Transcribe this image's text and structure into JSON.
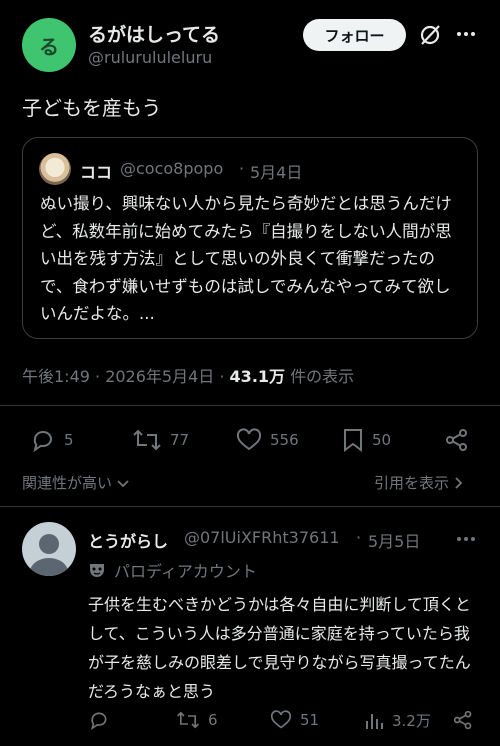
{
  "post": {
    "author_name": "るがはしってる",
    "author_handle": "@rulurululeluru",
    "avatar_glyph": "る",
    "follow_label": "フォロー",
    "text": "子どもを産もう",
    "timestamp": "午後1:49 · 2026年5月4日 ·",
    "views_count": "43.1万",
    "views_label": "件の表示"
  },
  "quote": {
    "name": "ココ",
    "handle": "@coco8popo",
    "dot": "·",
    "date": "5月4日",
    "body": "ぬい撮り、興味ない人から見たら奇妙だとは思うんだけど、私数年前に始めてみたら『自撮りをしない人間が思い出を残す方法』として思いの外良くて衝撃だったので、食わず嫌いせずものは試しでみんなやってみて欲しいんだよな。..."
  },
  "actions": {
    "replies": "5",
    "reposts": "77",
    "likes": "556",
    "bookmarks": "50"
  },
  "sort": {
    "left_label": "関連性が高い",
    "right_label": "引用を表示"
  },
  "reply": {
    "name": "とうがらし",
    "handle": "@07lUiXFRht37611",
    "dot": "·",
    "date": "5月5日",
    "parody_label": "パロディアカウント",
    "body": "子供を生むべきかどうかは各々自由に判断して頂くとして、こういう人は多分普通に家庭を持っていたら我が子を慈しみの眼差しで見守りながら写真撮ってたんだろうなぁと思う",
    "actions": {
      "replies": "",
      "reposts": "6",
      "likes": "51",
      "views": "3.2万"
    }
  },
  "colors": {
    "background": "#000000",
    "text": "#e7e9ea",
    "muted": "#71767b",
    "divider": "#2f3336",
    "avatar_green": "#3fc46f"
  }
}
